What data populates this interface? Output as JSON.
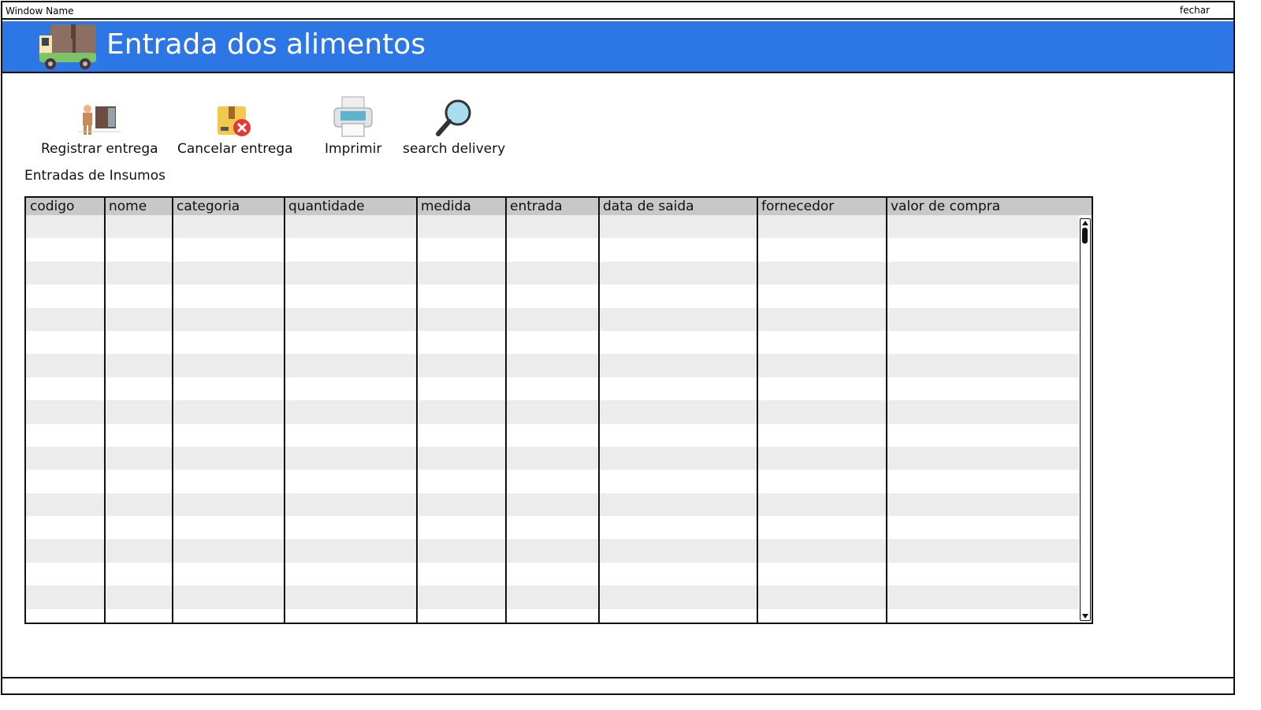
{
  "window": {
    "title": "Window Name",
    "close_label": "fechar"
  },
  "header": {
    "title": "Entrada dos alimentos",
    "icon": "truck-icon",
    "color": "#2c77e5"
  },
  "toolbar": [
    {
      "label": "Registrar entrega",
      "icon": "delivery-man-icon"
    },
    {
      "label": "Cancelar entrega",
      "icon": "cancel-package-icon"
    },
    {
      "label": "Imprimir",
      "icon": "printer-icon"
    },
    {
      "label": "search delivery",
      "icon": "magnifier-icon"
    }
  ],
  "section_title": "Entradas de Insumos",
  "table": {
    "columns": [
      "codigo",
      "nome",
      "categoria",
      "quantidade",
      "medida",
      "entrada",
      "data de saida",
      "fornecedor",
      "valor de compra"
    ],
    "rows": []
  }
}
